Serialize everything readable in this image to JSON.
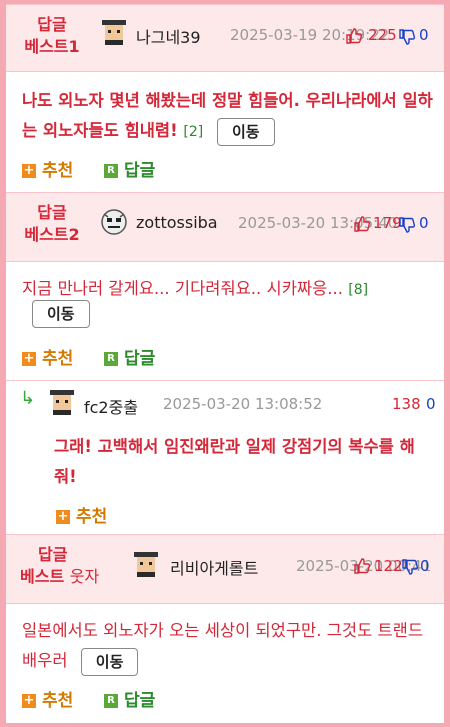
{
  "comments": [
    {
      "best_top": "답글",
      "best_bottom": "베스트1",
      "nick": "나그네39",
      "date": "2025-03-19 20:19:22",
      "likes": "225",
      "dislikes": "0",
      "text": "나도 외노자 몇년 해봤는데 정말 힘들어. 우리나라에서 일하는 외노자들도 힘내렴!",
      "reply_count": "[2]",
      "move": "이동",
      "recommend": "추천",
      "reply": "답글"
    },
    {
      "best_top": "답글",
      "best_bottom": "베스트2",
      "nick": "zottossiba",
      "date": "2025-03-20 13:05:40",
      "likes": "179",
      "dislikes": "0",
      "text": "지금 만나러 갈게요... 기다려줘요.. 시카짜응...",
      "reply_count": "[8]",
      "move": "이동",
      "recommend": "추천",
      "reply": "답글"
    },
    {
      "nick": "fc2중출",
      "date": "2025-03-20 13:08:52",
      "likes": "138",
      "dislikes": "0",
      "text": "그래! 고백해서 임진왜란과 일제 강점기의 복수를 해줘!",
      "recommend": "추천"
    },
    {
      "best_top": "답글",
      "best_bottom": "베스트",
      "best_extra": "웃자",
      "nick": "리비아게롤트",
      "date": "2025-03-20 00:41",
      "likes": "122",
      "dislikes": "0",
      "text": "일본에서도 외노자가 오는 세상이 되었구만. 그것도 트랜드 배우러",
      "move": "이동",
      "recommend": "추천",
      "reply": "답글"
    }
  ],
  "icons": {
    "thumb_up": "thumbs-up-icon",
    "thumb_down": "thumbs-down-icon",
    "plus": "plus-icon",
    "reply_badge": "reply-badge-icon",
    "reply_arrow": "reply-arrow-icon"
  },
  "colors": {
    "border": "#f5a9b2",
    "header_bg": "#fde8ea",
    "best_red": "#d42839",
    "dislike_blue": "#1a3fc7",
    "recommend_orange": "#d47a00",
    "reply_green": "#2d8a2d"
  }
}
